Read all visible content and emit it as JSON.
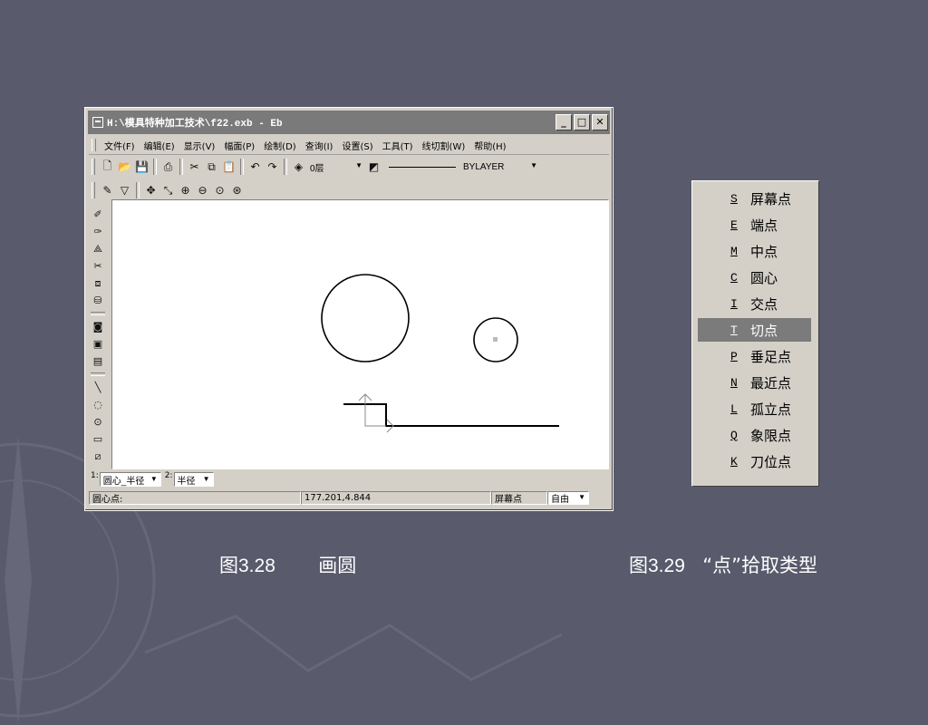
{
  "window": {
    "title": "H:\\模具特种加工技术\\f22.exb - Eb",
    "controls": {
      "minimize": "_",
      "maximize": "□",
      "close": "✕"
    }
  },
  "menu": [
    "文件(F)",
    "编辑(E)",
    "显示(V)",
    "幅面(P)",
    "绘制(D)",
    "查询(I)",
    "设置(S)",
    "工具(T)",
    "线切割(W)",
    "帮助(H)"
  ],
  "toolbar": {
    "layer": "0层",
    "linetype": "BYLAYER"
  },
  "command": {
    "label1": "1:",
    "option1": "圆心_半径",
    "label2": "2:",
    "option2": "半径"
  },
  "status": {
    "prompt": "圆心点:",
    "coords": "177.201,4.844",
    "snap": "屏幕点",
    "mode": "自由"
  },
  "point_menu": [
    {
      "key": "S",
      "label": "屏幕点"
    },
    {
      "key": "E",
      "label": "端点"
    },
    {
      "key": "M",
      "label": "中点"
    },
    {
      "key": "C",
      "label": "圆心"
    },
    {
      "key": "I",
      "label": "交点"
    },
    {
      "key": "T",
      "label": "切点",
      "selected": true
    },
    {
      "key": "P",
      "label": "垂足点"
    },
    {
      "key": "N",
      "label": "最近点"
    },
    {
      "key": "L",
      "label": "孤立点"
    },
    {
      "key": "Q",
      "label": "象限点"
    },
    {
      "key": "K",
      "label": "刀位点"
    }
  ],
  "captions": {
    "left": {
      "number": "图3.28",
      "text": "画圆"
    },
    "right": {
      "number": "图3.29",
      "text": "“点”拾取类型"
    }
  },
  "colors": {
    "slide_background": "#595a6c",
    "window_chrome": "#d4d0c8",
    "selection": "#7b7b7b"
  }
}
